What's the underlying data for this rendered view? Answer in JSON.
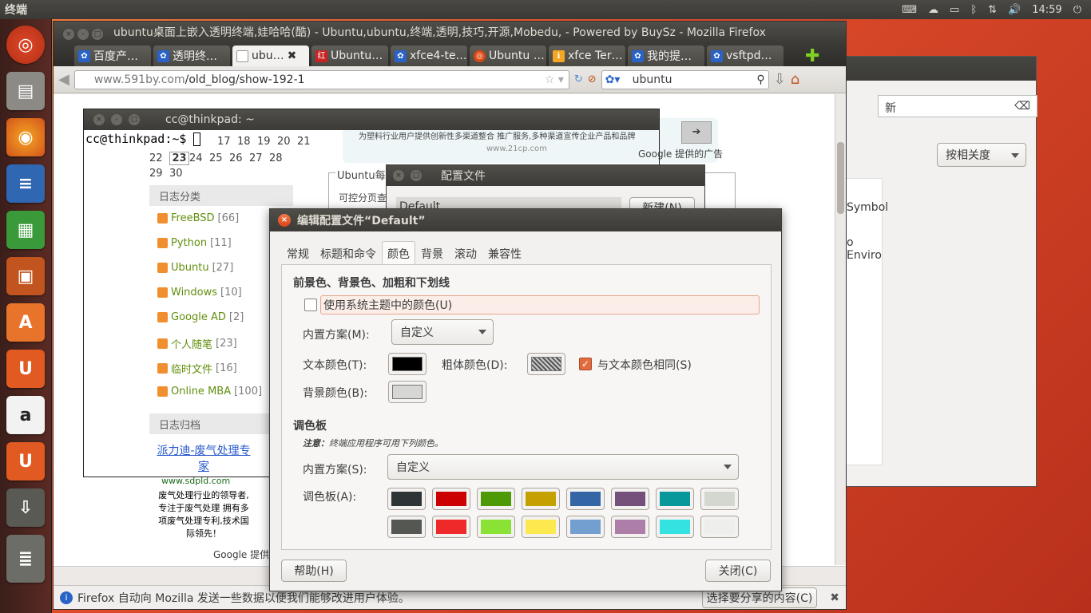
{
  "top_panel": {
    "app_name": "终端",
    "time": "14:59"
  },
  "firefox": {
    "window_title": "ubuntu桌面上嵌入透明终端,娃哈哈(酷) - Ubuntu,ubuntu,终端,透明,技巧,开源,Mobedu, - Powered by BuySz - Mozilla Firefox",
    "tabs": [
      {
        "label": "百度产…"
      },
      {
        "label": "透明终…"
      },
      {
        "label": "ubu…"
      },
      {
        "label": "Ubuntu…"
      },
      {
        "label": "xfce4-te…"
      },
      {
        "label": "Ubuntu …"
      },
      {
        "label": "xfce Ter…"
      },
      {
        "label": "我的提…"
      },
      {
        "label": "vsftpd…"
      }
    ],
    "url_host": "www.591by.com",
    "url_path": "/old_blog/show-192-1",
    "search_text": "ubuntu",
    "status_text": "Firefox 自动向 Mozilla 发送一些数据以便我们能够改进用户体验。",
    "status_button": "选择要分享的内容(C)"
  },
  "blog": {
    "calendar_rows": [
      [
        "22",
        "23",
        "24",
        "25",
        "26",
        "27",
        "28"
      ],
      [
        "29",
        "30"
      ]
    ],
    "calendar_partial": [
      "17",
      "18",
      "19",
      "20",
      "21"
    ],
    "categories_title": "日志分类",
    "categories": [
      {
        "name": "FreeBSD",
        "count": "[66]"
      },
      {
        "name": "Python",
        "count": "[11]"
      },
      {
        "name": "Ubuntu",
        "count": "[27]"
      },
      {
        "name": "Windows",
        "count": "[10]"
      },
      {
        "name": "Google AD",
        "count": "[2]"
      },
      {
        "name": "个人随笔",
        "count": "[23]"
      },
      {
        "name": "临时文件",
        "count": "[16]"
      },
      {
        "name": "Online MBA",
        "count": "[100]"
      }
    ],
    "archive_title": "日志归档",
    "ad_link": "派力迪-废气处理专家",
    "ad_url": "www.sdpld.com",
    "ad_text": "废气处理行业的领导者,专注于废气处理 拥有多项废气处理专利,技术国际领先！",
    "ad_top": "为塑料行业用户提供创新性多渠道整合 推广服务,多种渠道宣传企业产品和品牌",
    "ad_top_url": "www.21cp.com",
    "google_label": "Google 提供的广告",
    "box_title": "Ubuntu每日",
    "box_text": "可控分页查"
  },
  "terminal": {
    "title": "cc@thinkpad: ~",
    "prompt": "cc@thinkpad:~$"
  },
  "profiles": {
    "title": "配置文件",
    "item": "Default",
    "new_button": "新建(N)"
  },
  "bgwin": {
    "sort": "按相关度",
    "t1": "Symbol",
    "t2": "o Enviro",
    "t3": "新"
  },
  "dialog": {
    "title": "编辑配置文件“Default”",
    "tabs": [
      "常规",
      "标题和命令",
      "颜色",
      "背景",
      "滚动",
      "兼容性"
    ],
    "section1": "前景色、背景色、加粗和下划线",
    "use_system": "使用系统主题中的颜色(U)",
    "scheme_label": "内置方案(M):",
    "scheme_value": "自定义",
    "text_color_label": "文本颜色(T):",
    "bold_color_label": "粗体颜色(D):",
    "same_as_text": "与文本颜色相同(S)",
    "bg_color_label": "背景颜色(B):",
    "palette_title": "调色板",
    "note_label": "注意：",
    "note_text": "终端应用程序可用下列颜色。",
    "palette_scheme_label": "内置方案(S):",
    "palette_scheme_value": "自定义",
    "palette_label": "调色板(A):",
    "palette_row1": [
      "#2e3436",
      "#cc0000",
      "#4e9a06",
      "#c4a000",
      "#3465a4",
      "#75507b",
      "#06989a",
      "#d3d7cf"
    ],
    "palette_row2": [
      "#555753",
      "#ef2929",
      "#8ae234",
      "#fce94f",
      "#729fcf",
      "#ad7fa8",
      "#34e2e2",
      "#eeeeec"
    ],
    "text_color": "#000000",
    "bg_color": "#d6d6d4",
    "help_button": "帮助(H)",
    "close_button": "关闭(C)"
  }
}
